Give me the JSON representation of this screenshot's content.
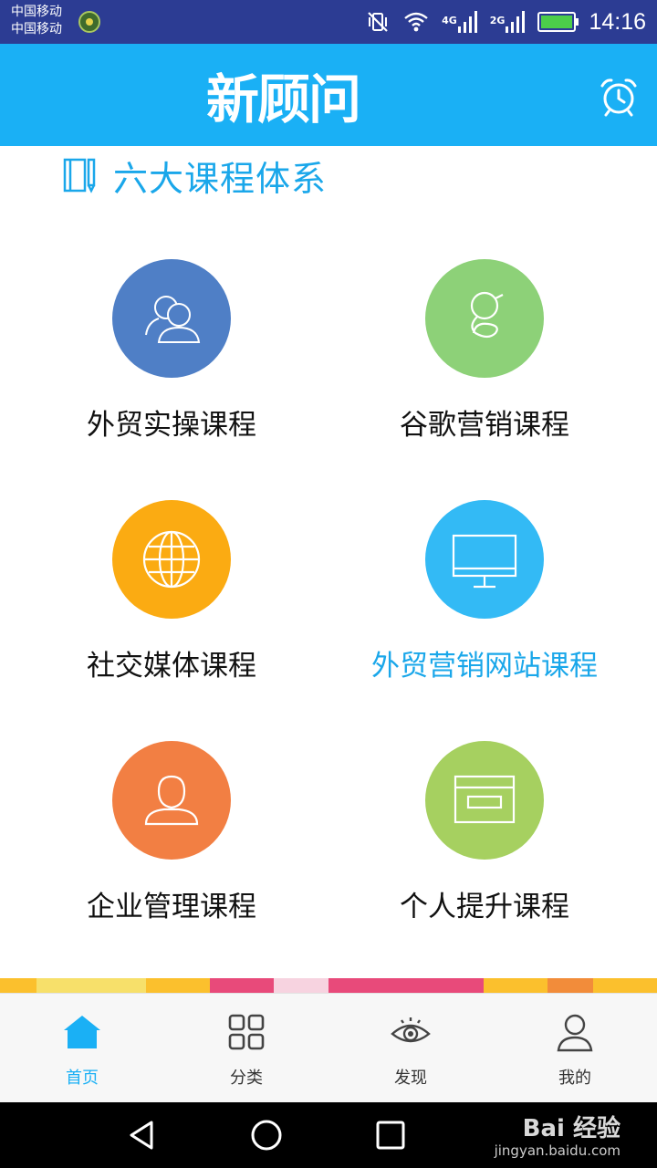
{
  "status_bar": {
    "carrier_1": "中国移动",
    "carrier_2": "中国移动",
    "net_1": "4G",
    "net_2": "2G",
    "time": "14:16"
  },
  "header": {
    "logo_text": "新顾问",
    "alarm_icon": "alarm-clock-icon"
  },
  "section": {
    "title": "六大课程体系",
    "icon": "notebook-icon"
  },
  "courses": [
    {
      "label": "外贸实操课程",
      "color": "#4f7fc6",
      "icon": "users-icon",
      "highlight": false
    },
    {
      "label": "谷歌营销课程",
      "color": "#8dd178",
      "icon": "google-g-icon",
      "highlight": false
    },
    {
      "label": "社交媒体课程",
      "color": "#fbab12",
      "icon": "globe-icon",
      "highlight": false
    },
    {
      "label": "外贸营销网站课程",
      "color": "#33baf5",
      "icon": "monitor-icon",
      "highlight": true
    },
    {
      "label": "企业管理课程",
      "color": "#f27f43",
      "icon": "person-icon",
      "highlight": false
    },
    {
      "label": "个人提升课程",
      "color": "#a6d060",
      "icon": "card-icon",
      "highlight": false
    }
  ],
  "bottom_nav": [
    {
      "label": "首页",
      "icon": "home-icon",
      "active": true
    },
    {
      "label": "分类",
      "icon": "grid-icon",
      "active": false
    },
    {
      "label": "发现",
      "icon": "eye-icon",
      "active": false
    },
    {
      "label": "我的",
      "icon": "user-icon",
      "active": false
    }
  ],
  "colors": {
    "accent": "#1ab0f5",
    "status_bar": "#2c3c93",
    "banner": "#fbc02d"
  },
  "watermark": {
    "brand": "Bai 经验",
    "url": "jingyan.baidu.com"
  }
}
